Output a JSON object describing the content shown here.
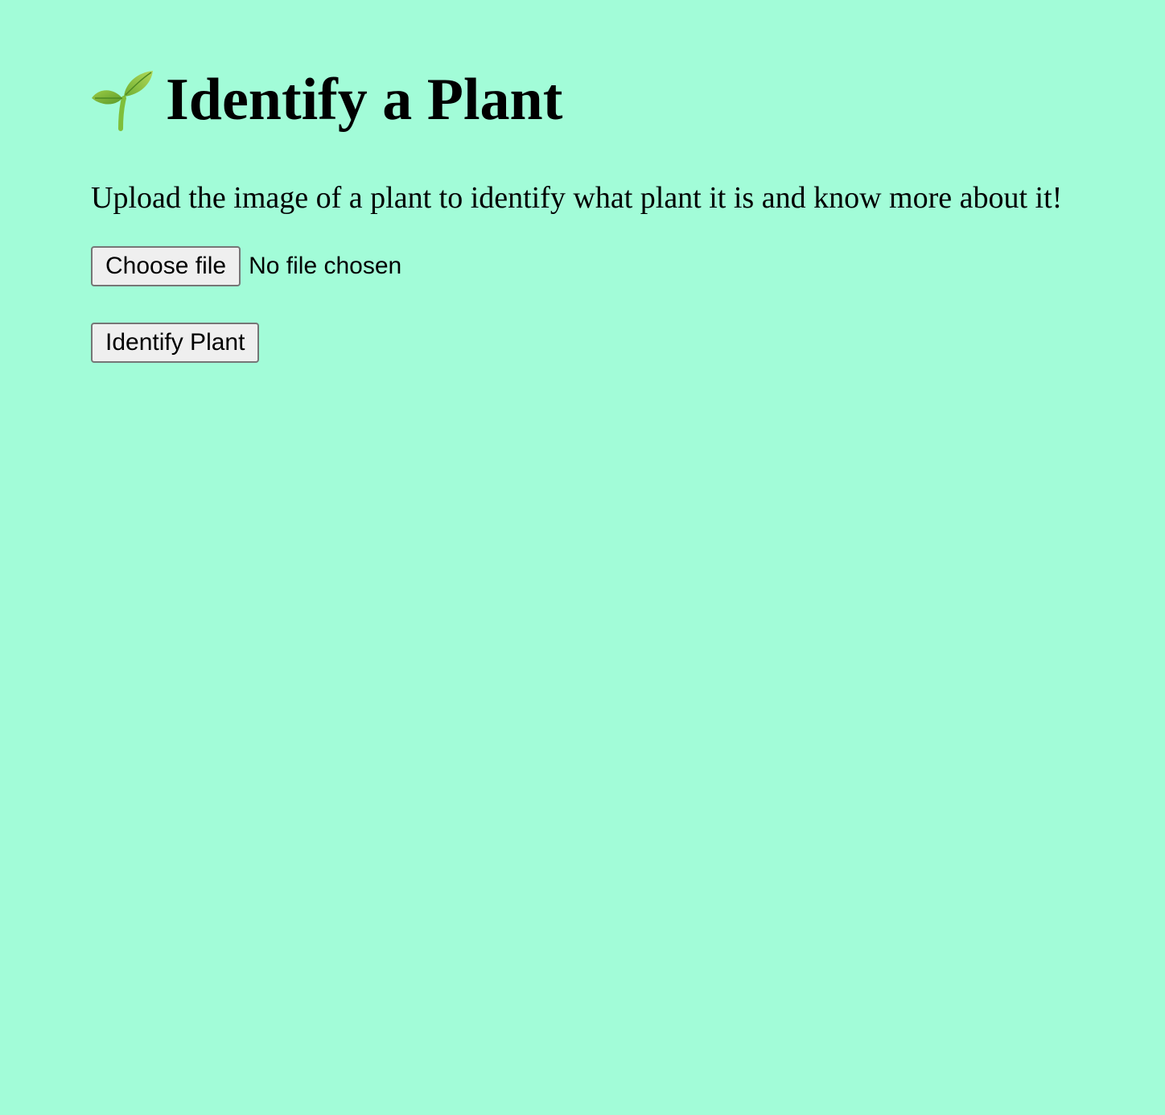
{
  "header": {
    "icon": "sprout-icon",
    "title": "Identify a Plant"
  },
  "description": "Upload the image of a plant to identify what plant it is and know more about it!",
  "upload": {
    "choose_label": "Choose file",
    "status": "No file chosen"
  },
  "actions": {
    "identify_label": "Identify Plant"
  },
  "colors": {
    "background": "#a2fcd8",
    "button_bg": "#efefef",
    "button_border": "#767676"
  }
}
